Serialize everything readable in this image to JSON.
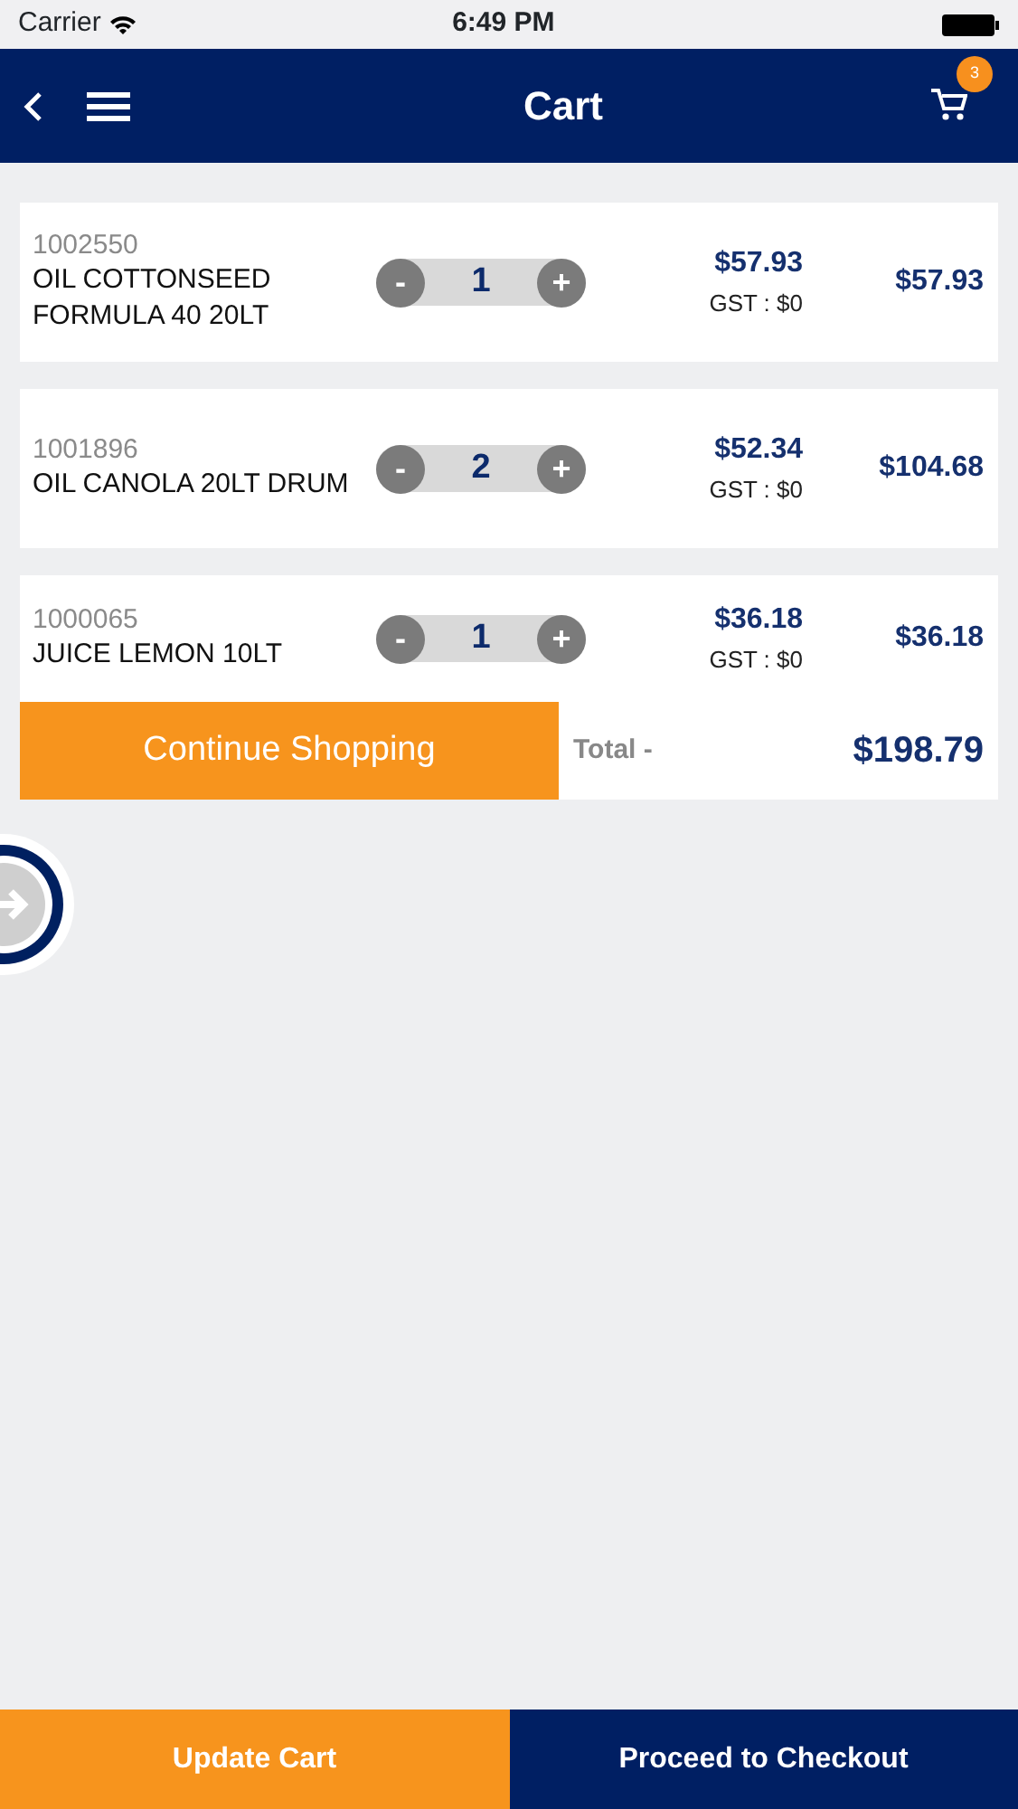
{
  "status_bar": {
    "carrier": "Carrier",
    "time": "6:49 PM"
  },
  "header": {
    "title": "Cart",
    "cart_count": "3"
  },
  "items": [
    {
      "code": "1002550",
      "name": "OIL COTTONSEED FORMULA 40 20LT",
      "minus": "-",
      "quantity": "1",
      "plus": "+",
      "price": "$57.93",
      "gst": "GST : $0",
      "line_total": "$57.93"
    },
    {
      "code": "1001896",
      "name": "OIL CANOLA 20LT DRUM",
      "minus": "-",
      "quantity": "2",
      "plus": "+",
      "price": "$52.34",
      "gst": "GST : $0",
      "line_total": "$104.68"
    },
    {
      "code": "1000065",
      "name": "JUICE LEMON 10LT",
      "minus": "-",
      "quantity": "1",
      "plus": "+",
      "price": "$36.18",
      "gst": "GST : $0",
      "line_total": "$36.18"
    }
  ],
  "summary": {
    "continue_button": "Continue Shopping",
    "total_label": "Total -",
    "total": "$198.79"
  },
  "bottom_bar": {
    "update_button": "Update Cart",
    "checkout_button": "Proceed to Checkout"
  }
}
